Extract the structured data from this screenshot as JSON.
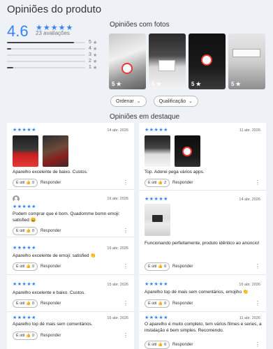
{
  "page": {
    "title": "Opiniões do produto"
  },
  "rating": {
    "score": "4.6",
    "stars": "★★★★★",
    "count": "23 avaliações",
    "distribution": [
      {
        "label": "5",
        "fraction": 0.86
      },
      {
        "label": "4",
        "fraction": 0.05
      },
      {
        "label": "3",
        "fraction": 0.0
      },
      {
        "label": "2",
        "fraction": 0.0
      },
      {
        "label": "1",
        "fraction": 0.08
      }
    ]
  },
  "photos": {
    "title": "Opiniões com fotos",
    "items": [
      {
        "tag": "5 ★"
      },
      {
        "tag": "5 ★"
      },
      {
        "tag": "5 ★"
      },
      {
        "tag": "5 ★"
      }
    ]
  },
  "filters": {
    "order": "Ordenar",
    "qualification": "Qualificação"
  },
  "featured": {
    "title": "Opiniões em destaque"
  },
  "colors": {
    "accent": "#3483fa",
    "brand_red": "#e53935"
  },
  "reviews_left": [
    {
      "stars": "★★★★★",
      "date": "14 abr. 2026",
      "text": "Aparelho excelente de baixo. Custos.",
      "util": "É útil",
      "likes": "0",
      "reply": "Responder"
    },
    {
      "stars": "★★★★★",
      "date": "16 abr. 2026",
      "text": "Podem comprar que é bom. Quadomme bomn emoji: satisfied 😀",
      "util": "É útil",
      "likes": "0",
      "reply": "Responder"
    },
    {
      "stars": "★★★★★",
      "date": "16 abr. 2026",
      "text": "Aparelho excelente de emoji: satisfied 👏",
      "util": "É útil",
      "likes": "0",
      "reply": "Responder"
    },
    {
      "stars": "★★★★★",
      "date": "15 abr. 2026",
      "text": "Aparelho excelente e baixo. Custos.",
      "util": "É útil",
      "likes": "0",
      "reply": "Responder"
    },
    {
      "stars": "★★★★★",
      "date": "16 abr. 2026",
      "text": "Aparelho top dé mais sem comentários.",
      "util": "É útil",
      "likes": "0",
      "reply": "Responder"
    }
  ],
  "reviews_right": [
    {
      "stars": "★★★★★",
      "date": "11 abr. 2026",
      "text": "Top. Adorei pega vários apps.",
      "util": "É útil",
      "likes": "2",
      "reply": "Responder"
    },
    {
      "stars": "★★★★★",
      "date": "14 abr. 2026",
      "text": "Funcionando perfeitamente, produto idêntico ao anúncio!",
      "util": "É útil",
      "likes": "0",
      "reply": "Responder"
    },
    {
      "stars": "★★★★★",
      "date": "16 abr. 2026",
      "text": "Aparelho top dé mais sem comentários, emojiho 👏",
      "util": "É útil",
      "likes": "0",
      "reply": "Responder"
    },
    {
      "stars": "★★★★★",
      "date": "11 abr. 2026",
      "text": "O aparelho é muito completo, tem vários filmes e series, a instalação é bem simples. Recomendo.",
      "util": "É útil",
      "likes": "0",
      "reply": "Responder"
    }
  ]
}
